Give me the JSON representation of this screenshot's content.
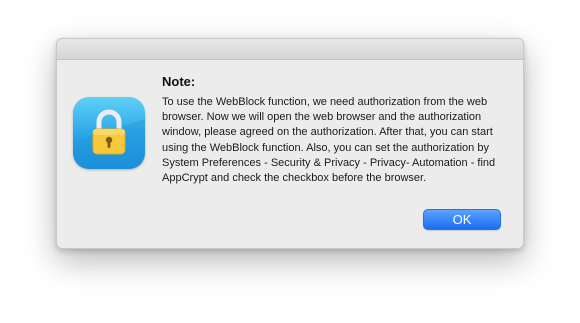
{
  "dialog": {
    "icon": "padlock-app-icon",
    "heading": "Note:",
    "message": "To use the WebBlock function, we need authorization from the web browser. Now we will open the web browser and the authorization window, please agreed on the authorization. After that, you can start using the WebBlock function. Also, you can set the authorization by System Preferences - Security & Privacy - Privacy- Automation - find AppCrypt and check the checkbox before the browser.",
    "ok_label": "OK"
  },
  "colors": {
    "dialog_background": "#ececec",
    "icon_gradient_top": "#5fd0f6",
    "icon_gradient_bottom": "#1a8fd8",
    "lock_body": "#f7c83a",
    "ok_button": "#1a6df2"
  }
}
